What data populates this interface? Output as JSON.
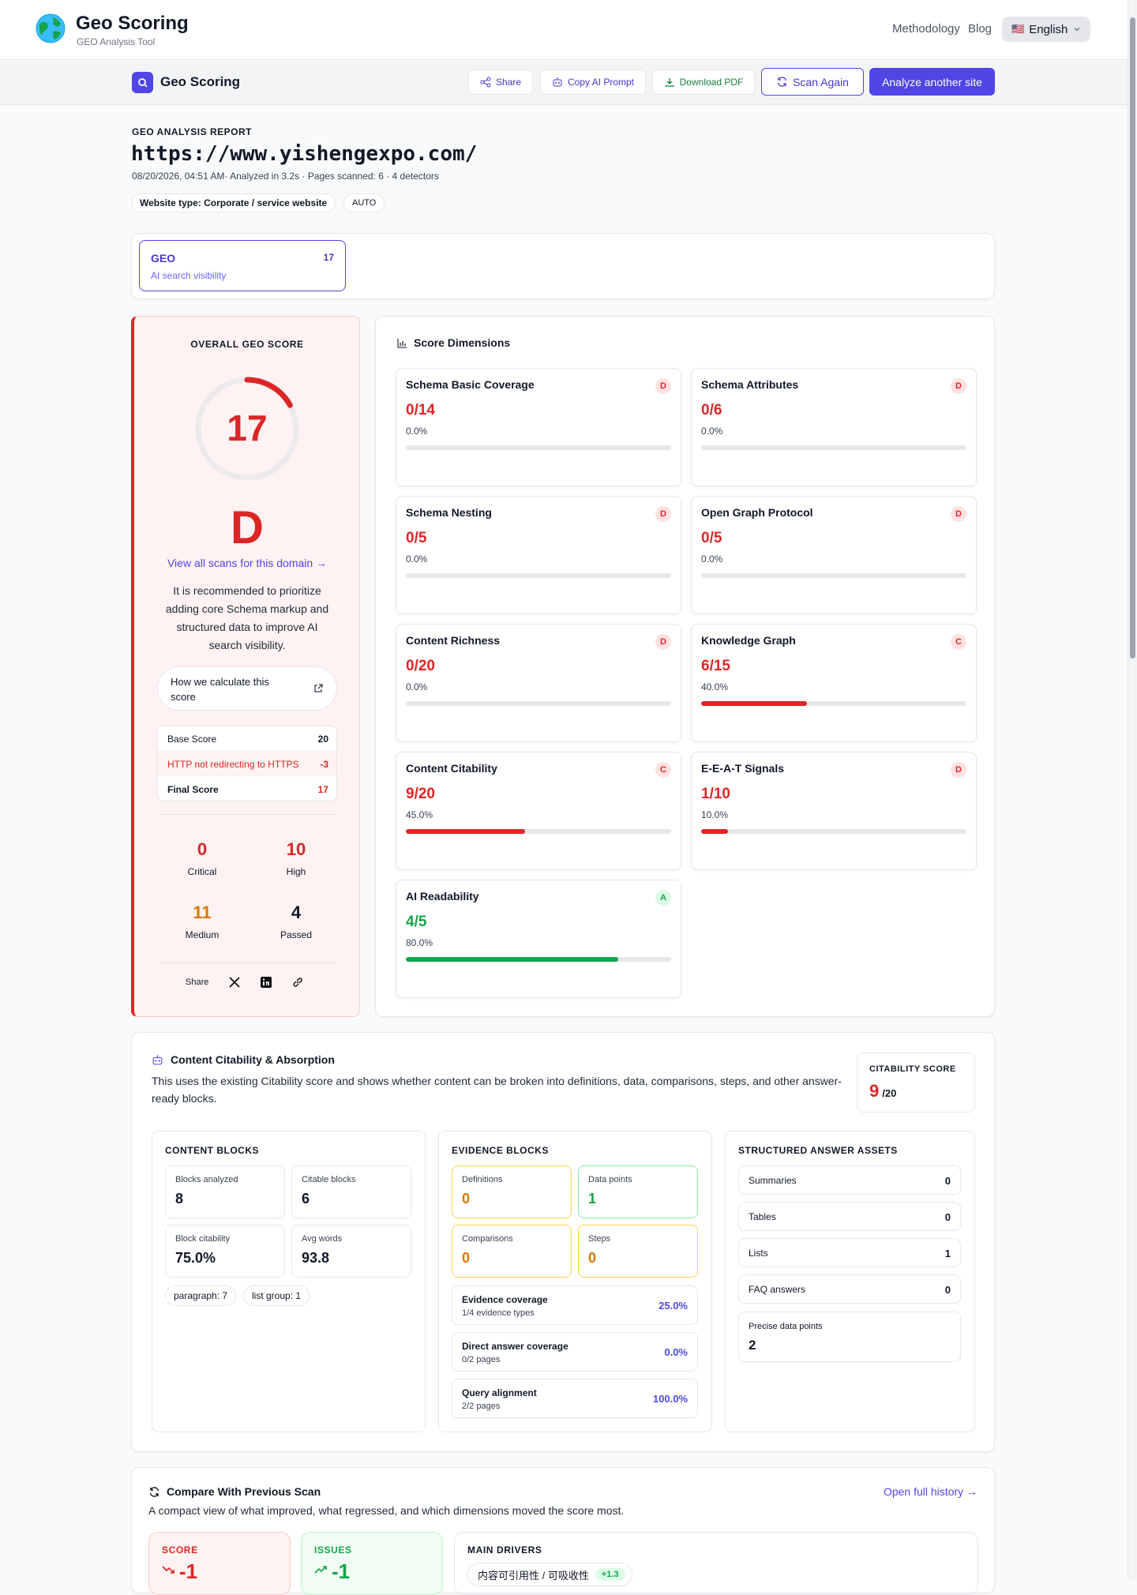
{
  "header": {
    "title": "Geo Scoring",
    "subtitle": "GEO Analysis Tool",
    "nav": [
      "Methodology",
      "Blog"
    ],
    "language": "English",
    "flag": "🇺🇸"
  },
  "subbar": {
    "title": "Geo Scoring",
    "share": "Share",
    "copy_prompt": "Copy AI Prompt",
    "download": "Download PDF",
    "scan_again": "Scan Again",
    "analyze": "Analyze another site"
  },
  "report": {
    "label": "GEO ANALYSIS REPORT",
    "url": "https://www.yishengexpo.com/",
    "meta": "08/20/2026, 04:51 AM· Analyzed in 3.2s · Pages scanned: 6 · 4 detectors",
    "website_type": "Website type: Corporate / service website",
    "auto": "AUTO"
  },
  "tab": {
    "name": "GEO",
    "score": "17",
    "desc": "AI search visibility"
  },
  "overall": {
    "label": "OVERALL GEO SCORE",
    "score": "17",
    "score_value": 17,
    "score_max": 100,
    "grade": "D",
    "view_all": "View all scans for this domain →",
    "recommendation": "It is recommended to prioritize adding core Schema markup and structured data to improve AI search visibility.",
    "how": "How we calculate this score",
    "breakdown": [
      {
        "label": "Base Score",
        "value": "20"
      },
      {
        "label": "HTTP not redirecting to HTTPS",
        "value": "-3"
      },
      {
        "label": "Final Score",
        "value": "17"
      }
    ],
    "counts": [
      {
        "value": "0",
        "label": "Critical"
      },
      {
        "value": "10",
        "label": "High"
      },
      {
        "value": "11",
        "label": "Medium"
      },
      {
        "value": "4",
        "label": "Passed"
      }
    ],
    "share": "Share"
  },
  "dimensions": {
    "title": "Score Dimensions",
    "items": [
      {
        "name": "Schema Basic Coverage",
        "score": "0/14",
        "pct": "0.0%",
        "grade": "D",
        "fill": 0
      },
      {
        "name": "Schema Attributes",
        "score": "0/6",
        "pct": "0.0%",
        "grade": "D",
        "fill": 0
      },
      {
        "name": "Schema Nesting",
        "score": "0/5",
        "pct": "0.0%",
        "grade": "D",
        "fill": 0
      },
      {
        "name": "Open Graph Protocol",
        "score": "0/5",
        "pct": "0.0%",
        "grade": "D",
        "fill": 0
      },
      {
        "name": "Content Richness",
        "score": "0/20",
        "pct": "0.0%",
        "grade": "D",
        "fill": 0
      },
      {
        "name": "Knowledge Graph",
        "score": "6/15",
        "pct": "40.0%",
        "grade": "C",
        "fill": 40
      },
      {
        "name": "Content Citability",
        "score": "9/20",
        "pct": "45.0%",
        "grade": "C",
        "fill": 45
      },
      {
        "name": "E-E-A-T Signals",
        "score": "1/10",
        "pct": "10.0%",
        "grade": "D",
        "fill": 10
      },
      {
        "name": "AI Readability",
        "score": "4/5",
        "pct": "80.0%",
        "grade": "A",
        "fill": 80
      }
    ]
  },
  "citability": {
    "title": "Content Citability & Absorption",
    "desc": "This uses the existing Citability score and shows whether content can be broken into definitions, data, comparisons, steps, and other answer-ready blocks.",
    "score_label": "CITABILITY SCORE",
    "score": "9",
    "score_max": "/20",
    "content_blocks": {
      "title": "CONTENT BLOCKS",
      "items": [
        {
          "label": "Blocks analyzed",
          "value": "8"
        },
        {
          "label": "Citable blocks",
          "value": "6"
        },
        {
          "label": "Block citability",
          "value": "75.0%"
        },
        {
          "label": "Avg words",
          "value": "93.8"
        }
      ],
      "tags": [
        "paragraph: 7",
        "list group: 1"
      ]
    },
    "evidence_blocks": {
      "title": "EVIDENCE BLOCKS",
      "items": [
        {
          "label": "Definitions",
          "value": "0"
        },
        {
          "label": "Data points",
          "value": "1"
        },
        {
          "label": "Comparisons",
          "value": "0"
        },
        {
          "label": "Steps",
          "value": "0"
        }
      ],
      "rows": [
        {
          "label": "Evidence coverage",
          "sub": "1/4 evidence types",
          "value": "25.0%"
        },
        {
          "label": "Direct answer coverage",
          "sub": "0/2 pages",
          "value": "0.0%"
        },
        {
          "label": "Query alignment",
          "sub": "2/2 pages",
          "value": "100.0%"
        }
      ]
    },
    "structured": {
      "title": "STRUCTURED ANSWER ASSETS",
      "items": [
        {
          "label": "Summaries",
          "value": "0"
        },
        {
          "label": "Tables",
          "value": "0"
        },
        {
          "label": "Lists",
          "value": "1"
        },
        {
          "label": "FAQ answers",
          "value": "0"
        }
      ],
      "precise_label": "Precise data points",
      "precise_value": "2"
    }
  },
  "compare": {
    "title": "Compare With Previous Scan",
    "desc": "A compact view of what improved, what regressed, and which dimensions moved the score most.",
    "history": "Open full history →",
    "score_label": "SCORE",
    "score_value": "-1",
    "issues_label": "ISSUES",
    "issues_value": "-1",
    "drivers_label": "MAIN DRIVERS",
    "driver": "内容可引用性 / 可吸收性",
    "driver_delta": "+1.3"
  },
  "colors": {
    "accent": "#4f46e5",
    "red": "#dc2626",
    "green": "#16a34a",
    "orange": "#d97706"
  }
}
